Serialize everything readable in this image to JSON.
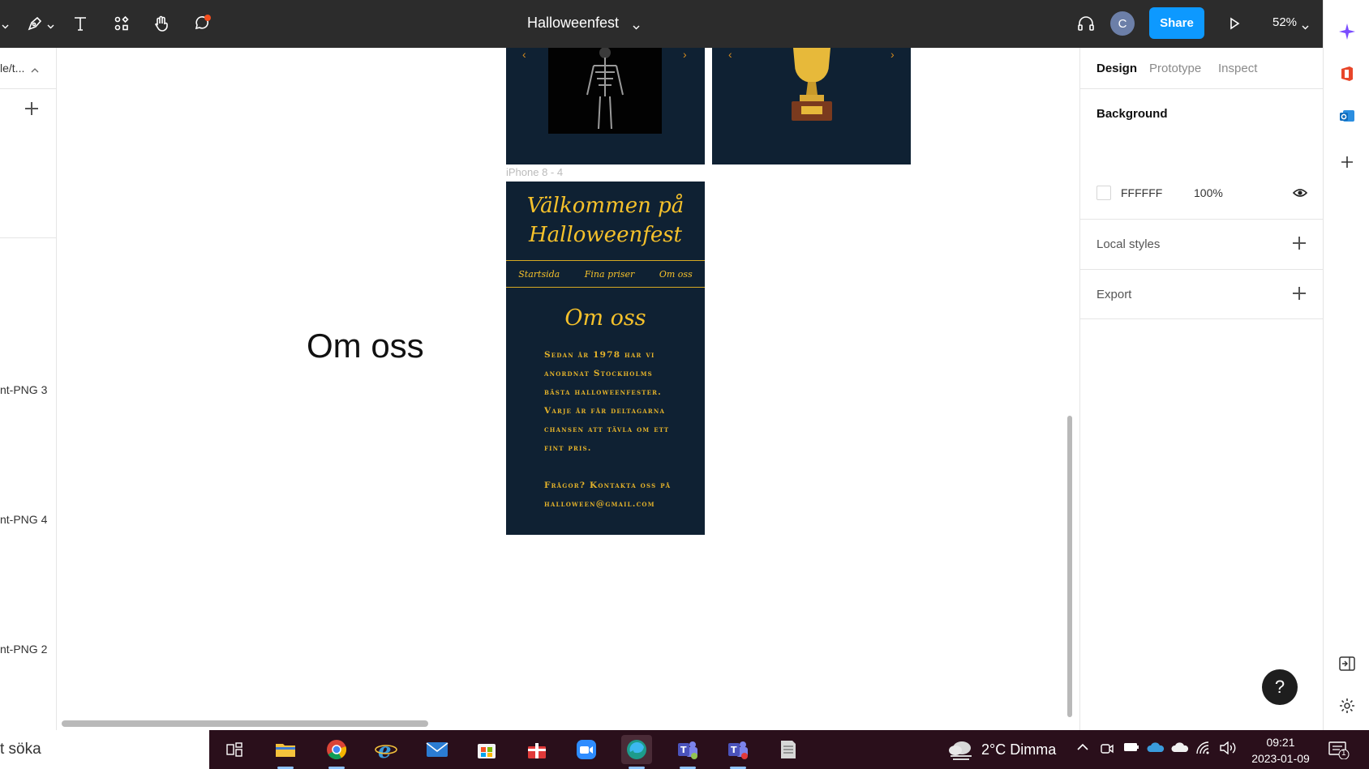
{
  "toolbar": {
    "document_title": "Halloweenfest",
    "share_label": "Share",
    "avatar_initial": "C",
    "zoom_level": "52%"
  },
  "left_panel": {
    "breadcrumb": "le/t...",
    "layers": [
      "nt-PNG 3",
      "nt-PNG 4",
      "nt-PNG 2"
    ]
  },
  "canvas": {
    "frame_label": "iPhone 8 - 4",
    "big_text": "Om oss",
    "mockup": {
      "title_line1": "Välkommen på",
      "title_line2": "Halloweenfest",
      "nav": [
        "Startsida",
        "Fina priser",
        "Om oss"
      ],
      "heading": "Om oss",
      "body_lines": [
        "Sedan år 1978 har vi",
        "anordnat Stockholms",
        "bästa halloweenfester.",
        "Varje år får deltagarna",
        "chansen att tävla om ett",
        "fint pris."
      ],
      "contact_lines": [
        "Frågor? Kontakta oss på",
        "halloween@gmail.com"
      ]
    }
  },
  "right_panel": {
    "tabs": [
      "Design",
      "Prototype",
      "Inspect"
    ],
    "background_title": "Background",
    "background_hex": "FFFFFF",
    "background_opacity": "100%",
    "local_styles": "Local styles",
    "export": "Export"
  },
  "help_label": "?",
  "taskbar": {
    "search_text": "t söka",
    "weather": "2°C  Dimma",
    "time": "09:21",
    "date": "2023-01-09",
    "notification_count": "1"
  },
  "colors": {
    "toolbar_bg": "#2c2c2c",
    "accent": "#0d99ff",
    "mockup_bg": "#0f2133",
    "mockup_gold": "#f5c12b",
    "taskbar_bg": "#2a0f1b"
  }
}
